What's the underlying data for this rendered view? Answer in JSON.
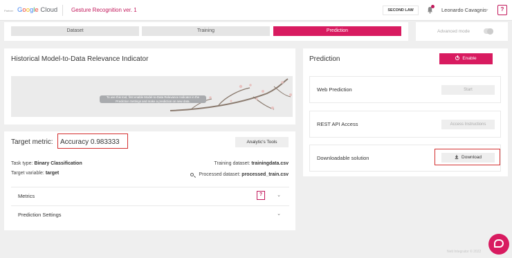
{
  "header": {
    "partner_label": "Partner",
    "brand": {
      "google": "Google",
      "cloud": "Cloud"
    },
    "app_title": "Gesture Recognition ver. 1",
    "workspace_button": "SECOND LAW",
    "user_name": "Leonardo Cavagnis",
    "help_label": "?"
  },
  "tabs": [
    "Dataset",
    "Training",
    "Prediction"
  ],
  "active_tab": "Prediction",
  "advanced_mode": {
    "label": "Advanced mode",
    "enabled": false
  },
  "historical": {
    "title": "Historical Model-to-Data Relevance Indicator",
    "tip": "To use this tool, first enable Model-to-Data Relevance Indicator in the Prediction Settings and make a prediction on new data."
  },
  "target_metric": {
    "label": "Target metric:",
    "value": "Accuracy 0.983333",
    "tools_button": "Analytic's Tools",
    "task_type_label": "Task type:",
    "task_type": "Binary Classification",
    "target_variable_label": "Target variable:",
    "target_variable": "target",
    "training_dataset_label": "Training dataset:",
    "training_dataset": "trainingdata.csv",
    "processed_dataset_label": "Processed dataset:",
    "processed_dataset": "processed_train.csv",
    "sections": [
      {
        "label": "Metrics",
        "help": "?"
      },
      {
        "label": "Prediction Settings"
      }
    ]
  },
  "prediction": {
    "title": "Prediction",
    "enable_button": "Enable",
    "cards": [
      {
        "label": "Web Prediction",
        "button": "Start"
      },
      {
        "label": "REST API Access",
        "button": "Access Instructions"
      },
      {
        "label": "Downloadable solution",
        "button": "Download"
      }
    ]
  },
  "footer": "Neti Integrator © 2022",
  "colors": {
    "accent": "#d81b60",
    "highlight_box": "#d32f2f"
  }
}
